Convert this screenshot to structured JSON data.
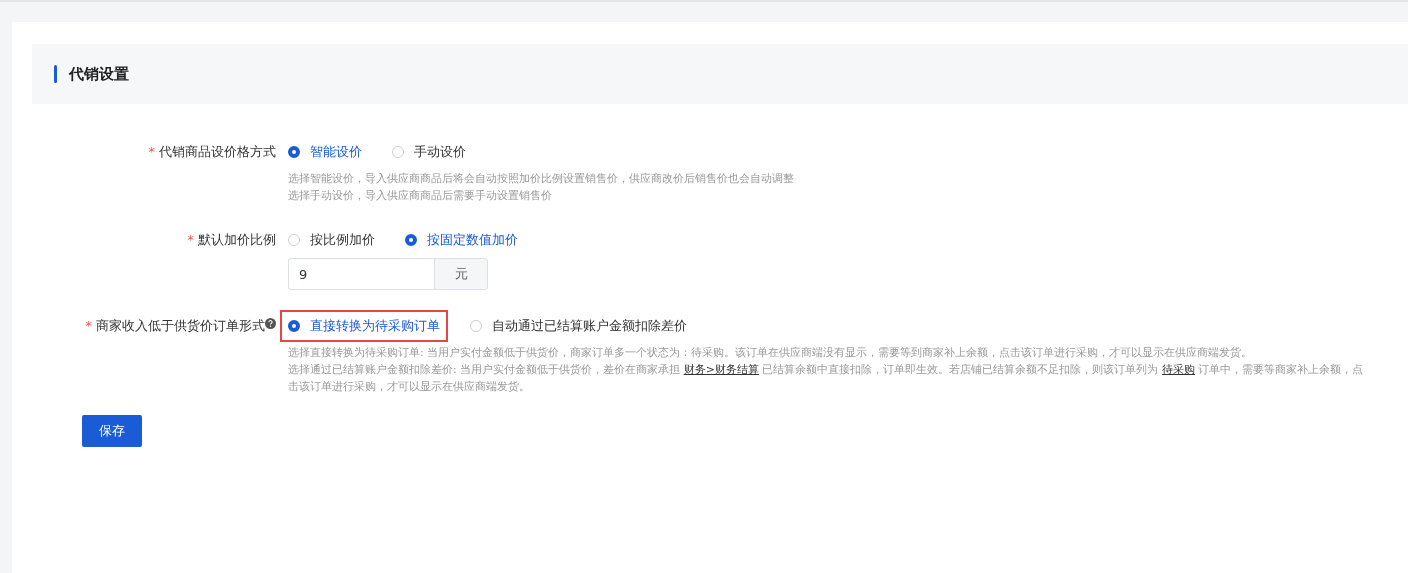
{
  "section": {
    "title": "代销设置"
  },
  "fields": [
    {
      "kind": "radio",
      "mark": "*",
      "label": "代销商品设价格方式",
      "options": [
        {
          "label": "智能设价",
          "selected": true
        },
        {
          "label": "手动设价",
          "selected": false
        }
      ],
      "help": [
        [
          {
            "kind": "text",
            "text": "选择智能设价，导入供应商商品后将会自动按照加价比例设置销售价，供应商改价后销售价也会自动调整"
          }
        ],
        [
          {
            "kind": "text",
            "text": "选择手动设价，导入供应商商品后需要手动设置销售价"
          }
        ]
      ]
    },
    {
      "kind": "radio-input",
      "mark": "*",
      "label": "默认加价比例",
      "options": [
        {
          "label": "按比例加价",
          "selected": false
        },
        {
          "label": "按固定数值加价",
          "selected": true
        }
      ],
      "input": {
        "value": "9",
        "suffix": "元"
      }
    },
    {
      "kind": "radio",
      "mark": "*",
      "label": "商家收入低于供货价订单形式",
      "help_icon": true,
      "options": [
        {
          "label": "直接转换为待采购订单",
          "selected": true,
          "highlighted": true
        },
        {
          "label": "自动通过已结算账户金额扣除差价",
          "selected": false
        }
      ],
      "help": [
        [
          {
            "kind": "text",
            "text": "选择直接转换为待采购订单: 当用户实付金额低于供货价，商家订单多一个状态为：待采购。该订单在供应商端没有显示，需要等到商家补上余额，点击该订单进行采购，才可以显示在供应商端发货。"
          }
        ],
        [
          {
            "kind": "text",
            "text": "选择通过已结算账户金额扣除差价: 当用户实付金额低于供货价，差价在商家承担 "
          },
          {
            "kind": "link",
            "text": "财务>财务结算"
          },
          {
            "kind": "text",
            "text": " 已结算余额中直接扣除，订单即生效。若店铺已结算余额不足扣除，则该订单列为 "
          },
          {
            "kind": "link",
            "text": "待采购"
          },
          {
            "kind": "text",
            "text": " 订单中，需要等商家补上余额，点击该订单进行采购，才可以显示在供应商端发货。"
          }
        ]
      ]
    }
  ],
  "save_button": "保存"
}
